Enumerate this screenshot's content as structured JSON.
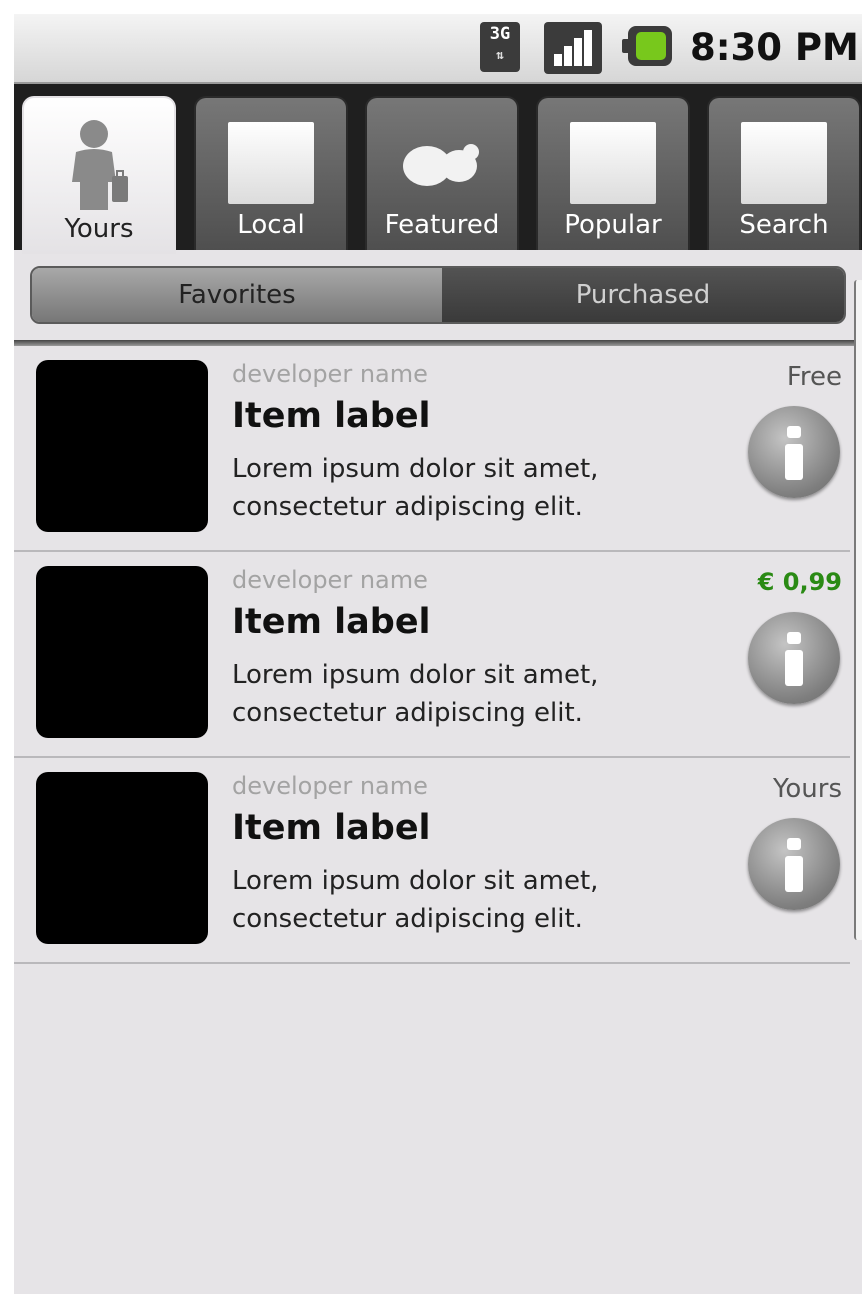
{
  "status_bar": {
    "network": "3G",
    "network_arrows": "⇅",
    "time": "8:30 PM"
  },
  "tabs": [
    {
      "label": "Yours",
      "active": true,
      "icon": "person-icon"
    },
    {
      "label": "Local",
      "active": false,
      "icon": "placeholder-icon"
    },
    {
      "label": "Featured",
      "active": false,
      "icon": "blob-icon"
    },
    {
      "label": "Popular",
      "active": false,
      "icon": "placeholder-icon"
    },
    {
      "label": "Search",
      "active": false,
      "icon": "placeholder-icon"
    }
  ],
  "segments": {
    "favorites": "Favorites",
    "purchased": "Purchased",
    "selected": "Favorites"
  },
  "items": [
    {
      "developer": "developer name",
      "title": "Item label",
      "description": "Lorem ipsum dolor sit amet, consectetur adipiscing elit.",
      "price": "Free"
    },
    {
      "developer": "developer name",
      "title": "Item label",
      "description": "Lorem ipsum dolor sit amet, consectetur adipiscing elit.",
      "price": "€ 0,99"
    },
    {
      "developer": "developer name",
      "title": "Item label",
      "description": "Lorem ipsum dolor sit amet, consectetur adipiscing elit.",
      "price": "Yours"
    }
  ],
  "colors": {
    "price_paid": "#2a8a14",
    "battery": "#78c81c",
    "background": "#e6e4e7"
  }
}
